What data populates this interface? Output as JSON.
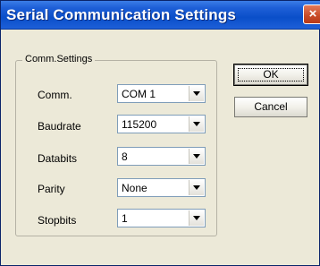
{
  "window": {
    "title": "Serial Communication Settings"
  },
  "titlebar": {
    "close_glyph": "×",
    "close_icon": "close-icon"
  },
  "group": {
    "legend": "Comm.Settings"
  },
  "fields": [
    {
      "label": "Comm.",
      "value": "COM 1"
    },
    {
      "label": "Baudrate",
      "value": "115200"
    },
    {
      "label": "Databits",
      "value": "8"
    },
    {
      "label": "Parity",
      "value": "None"
    },
    {
      "label": "Stopbits",
      "value": "1"
    }
  ],
  "buttons": {
    "ok": "OK",
    "cancel": "Cancel"
  },
  "colors": {
    "titlebar": "#0a4fc9",
    "window_bg": "#ece9d8",
    "close": "#c74a26"
  }
}
